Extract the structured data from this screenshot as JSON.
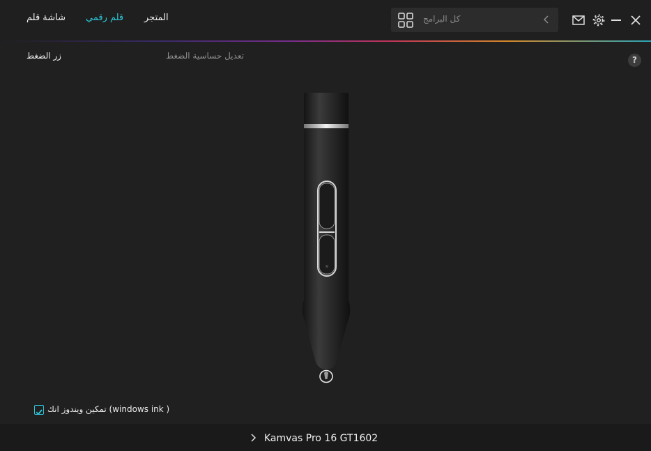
{
  "nav": {
    "tabs": [
      {
        "label": "شاشة قلم",
        "active": false
      },
      {
        "label": "قلم رقمي",
        "active": true
      },
      {
        "label": "المتجر",
        "active": false
      }
    ]
  },
  "search": {
    "placeholder": "كل البرامج",
    "grid_icon": "app-grid-icon",
    "back_icon": "chevron-left-icon"
  },
  "window_controls": {
    "icons": [
      "mail-icon",
      "gear-icon",
      "minimize-icon",
      "close-icon"
    ]
  },
  "subtabs": {
    "button": "زر الضغط",
    "pressure": "تعديل حساسية الضغط"
  },
  "help": {
    "label": "?"
  },
  "checkbox": {
    "label": "تمكين ويندوز انك (windows ink )",
    "checked": true
  },
  "footer": {
    "device_name": "Kamvas Pro 16 GT1602"
  },
  "colors": {
    "accent": "#2ec4d6",
    "background": "#202020",
    "bar": "#1a1a1a"
  }
}
